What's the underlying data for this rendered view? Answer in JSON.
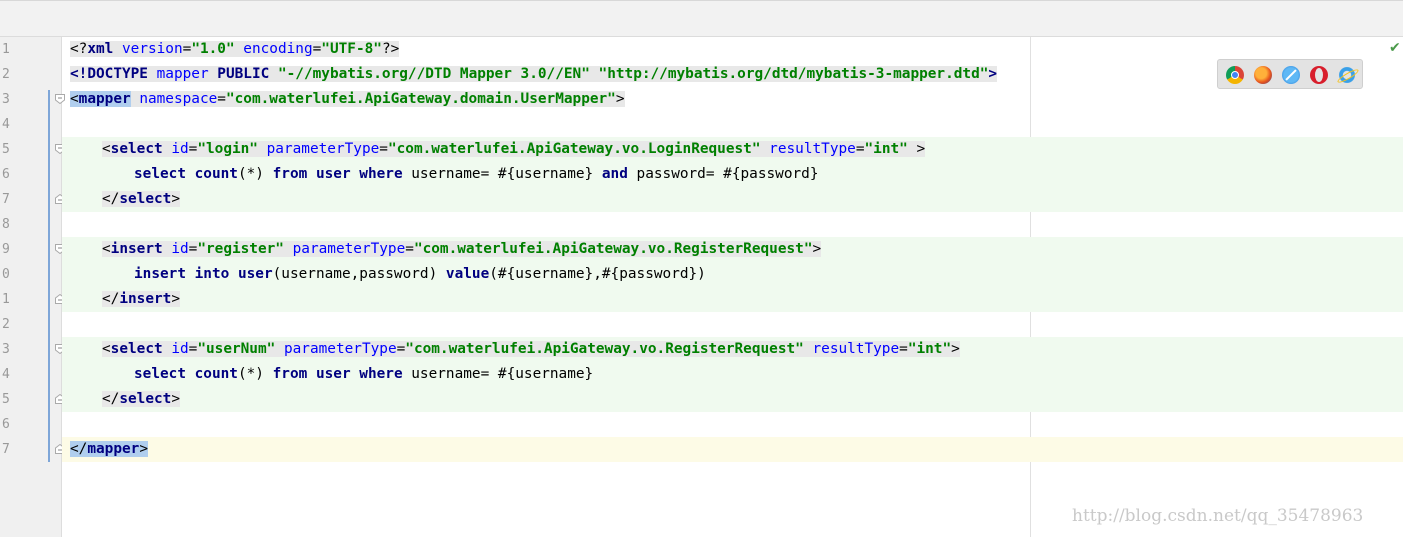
{
  "editor": {
    "line_numbers": [
      "1",
      "2",
      "3",
      "4",
      "5",
      "6",
      "7",
      "8",
      "9",
      "0",
      "1",
      "2",
      "3",
      "4",
      "5",
      "6",
      "7"
    ],
    "lines": {
      "l1": {
        "open": "<?",
        "tag": "xml",
        "a1": " version",
        "eq1": "=",
        "v1": "\"1.0\"",
        "a2": " encoding",
        "eq2": "=",
        "v2": "\"UTF-8\"",
        "close": "?>"
      },
      "l2": {
        "open": "<!",
        "tag": "DOCTYPE",
        "k1": " mapper",
        "k2": " PUBLIC",
        "v1": " \"-//mybatis.org//DTD Mapper 3.0//EN\"",
        "v2": " \"http://mybatis.org/dtd/mybatis-3-mapper.dtd\"",
        "close": ">"
      },
      "l3": {
        "open": "<",
        "tag": "mapper",
        "a1": " namespace",
        "eq1": "=",
        "v1": "\"com.waterlufei.ApiGateway.domain.UserMapper\"",
        "close": ">"
      },
      "l5": {
        "open": "<",
        "tag": "select",
        "a1": " id",
        "eq1": "=",
        "v1": "\"login\"",
        "a2": " parameterType",
        "eq2": "=",
        "v2": "\"com.waterlufei.ApiGateway.vo.LoginRequest\"",
        "a3": " resultType",
        "eq3": "=",
        "v3": "\"int\"",
        "close": " >"
      },
      "l6": {
        "k1": "select",
        "k2": " count",
        "p1": "(*)",
        "k3": " from",
        "k4": " user",
        "k5": " where",
        "n1": " username= #{username}",
        "k6": " and",
        "n2": " password= #{password}"
      },
      "l7": {
        "open": "</",
        "tag": "select",
        "close": ">"
      },
      "l9": {
        "open": "<",
        "tag": "insert",
        "a1": " id",
        "eq1": "=",
        "v1": "\"register\"",
        "a2": " parameterType",
        "eq2": "=",
        "v2": "\"com.waterlufei.ApiGateway.vo.RegisterRequest\"",
        "close": ">"
      },
      "l10": {
        "k1": "insert",
        "k2": " into",
        "k3": " user",
        "n1": "(username,password)",
        "k4": " value",
        "n2": "(#{username},#{password})"
      },
      "l11": {
        "open": "</",
        "tag": "insert",
        "close": ">"
      },
      "l13": {
        "open": "<",
        "tag": "select",
        "a1": " id",
        "eq1": "=",
        "v1": "\"userNum\"",
        "a2": " parameterType",
        "eq2": "=",
        "v2": "\"com.waterlufei.ApiGateway.vo.RegisterRequest\"",
        "a3": " resultType",
        "eq3": "=",
        "v3": "\"int\"",
        "close": ">"
      },
      "l14": {
        "k1": "select",
        "k2": " count",
        "p1": "(*)",
        "k3": " from",
        "k4": " user",
        "k5": " where",
        "n1": " username= #{username}"
      },
      "l15": {
        "open": "</",
        "tag": "select",
        "close": ">"
      },
      "l17": {
        "open": "</",
        "tag": "mapper",
        "close": ">"
      }
    }
  },
  "status": {
    "check_icon": "✔"
  },
  "browsers": [
    "chrome-icon",
    "firefox-icon",
    "safari-icon",
    "opera-icon",
    "ie-icon"
  ],
  "watermark": "http://blog.csdn.net/qq_35478963",
  "colors": {
    "tag": "#000080",
    "attr": "#0000ff",
    "value": "#008000",
    "highlight": "#f0faef",
    "caret_line": "#fdfbe6"
  }
}
